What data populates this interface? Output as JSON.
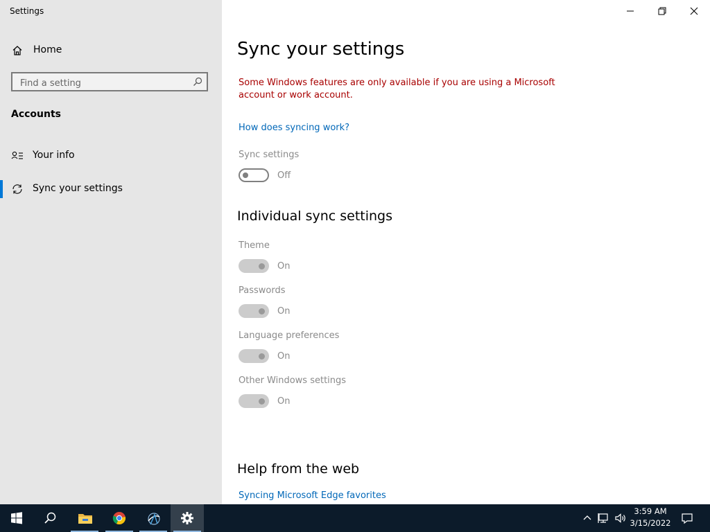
{
  "window": {
    "title": "Settings"
  },
  "sidebar": {
    "home_label": "Home",
    "search_placeholder": "Find a setting",
    "section_heading": "Accounts",
    "items": [
      {
        "label": "Your info",
        "icon": "person-list-icon",
        "active": false
      },
      {
        "label": "Sync your settings",
        "icon": "sync-icon",
        "active": true
      }
    ]
  },
  "main": {
    "title": "Sync your settings",
    "warning": "Some Windows features are only available if you are using a Microsoft account or work account.",
    "how_link": "How does syncing work?",
    "sync": {
      "label": "Sync settings",
      "state": "Off"
    },
    "individual_heading": "Individual sync settings",
    "individual": [
      {
        "label": "Theme",
        "state": "On"
      },
      {
        "label": "Passwords",
        "state": "On"
      },
      {
        "label": "Language preferences",
        "state": "On"
      },
      {
        "label": "Other Windows settings",
        "state": "On"
      }
    ],
    "help_heading": "Help from the web",
    "help_link": "Syncing Microsoft Edge favorites"
  },
  "taskbar": {
    "apps": [
      "windows-start-icon",
      "search-icon",
      "file-explorer-icon",
      "chrome-icon",
      "network-app-icon",
      "settings-gear-icon"
    ],
    "time": "3:59 AM",
    "date": "3/15/2022"
  },
  "colors": {
    "accent": "#0078d7",
    "warning": "#a80000",
    "link": "#0067b8",
    "taskbar": "#0c1b2a"
  }
}
